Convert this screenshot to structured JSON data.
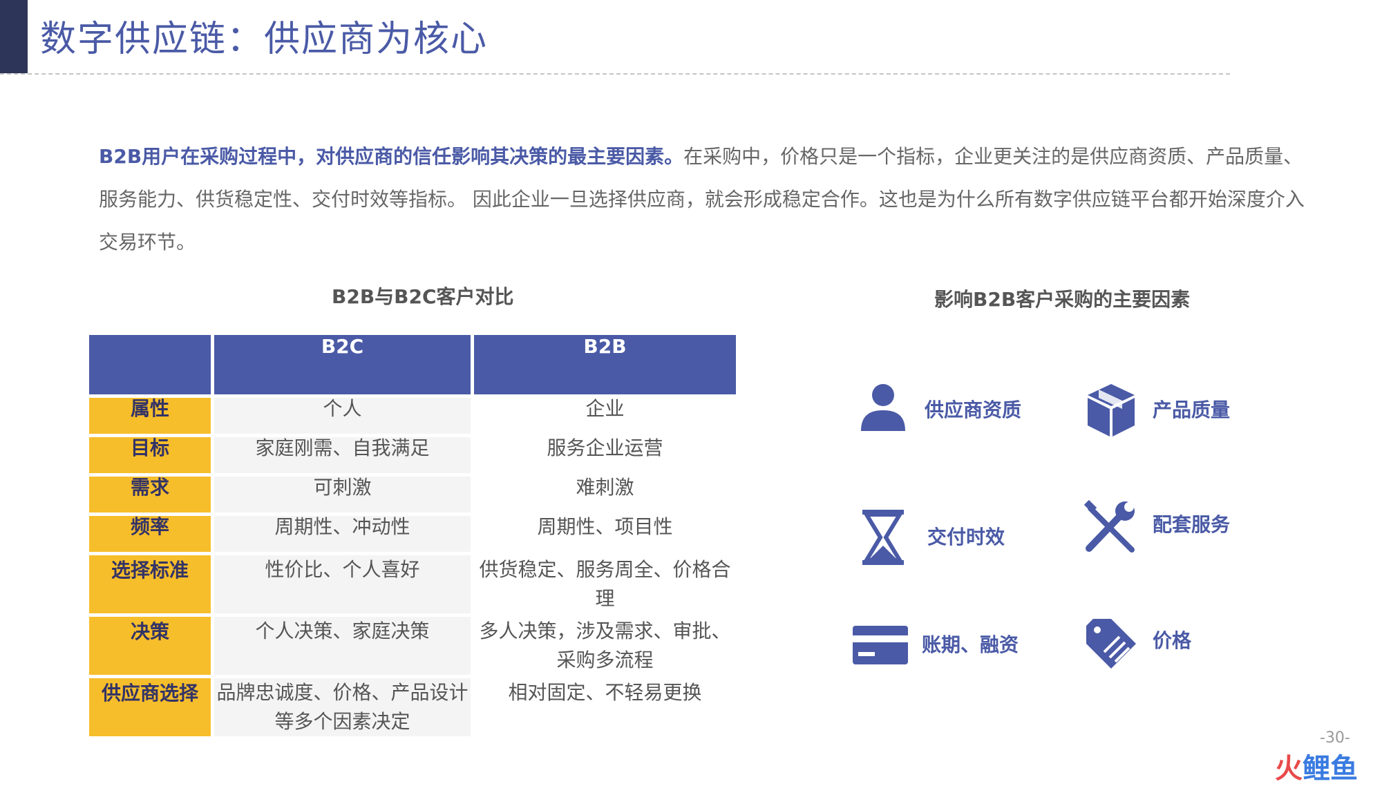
{
  "page": {
    "title": "数字供应链：供应商为核心",
    "page_number": "-30-"
  },
  "intro": {
    "highlight": "B2B用户在采购过程中，对供应商的信任影响其决策的最主要因素。",
    "body": "在采购中，价格只是一个指标，企业更关注的是供应商资质、产品质量、服务能力、供货稳定性、交付时效等指标。 因此企业一旦选择供应商，就会形成稳定合作。这也是为什么所有数字供应链平台都开始深度介入交易环节。"
  },
  "comparison": {
    "title": "B2B与B2C客户对比",
    "headers": [
      "",
      "B2C",
      "B2B"
    ],
    "rows": [
      {
        "label": "属性",
        "b2c": "个人",
        "b2b": "企业"
      },
      {
        "label": "目标",
        "b2c": "家庭刚需、自我满足",
        "b2b": "服务企业运营"
      },
      {
        "label": "需求",
        "b2c": "可刺激",
        "b2b": "难刺激"
      },
      {
        "label": "频率",
        "b2c": "周期性、冲动性",
        "b2b": "周期性、项目性"
      },
      {
        "label": "选择标准",
        "b2c": "性价比、个人喜好",
        "b2b": "供货稳定、服务周全、价格合理"
      },
      {
        "label": "决策",
        "b2c": "个人决策、家庭决策",
        "b2b": "多人决策，涉及需求、审批、采购多流程"
      },
      {
        "label": "供应商选择",
        "b2c": "品牌忠诚度、价格、产品设计等多个因素决定",
        "b2b": "相对固定、不轻易更换"
      }
    ]
  },
  "factors": {
    "title": "影响B2B客户采购的主要因素",
    "items": [
      {
        "label": "供应商资质",
        "icon": "person-icon"
      },
      {
        "label": "产品质量",
        "icon": "package-box-icon"
      },
      {
        "label": "交付时效",
        "icon": "hourglass-icon"
      },
      {
        "label": "配套服务",
        "icon": "tools-icon"
      },
      {
        "label": "账期、融资",
        "icon": "credit-card-icon"
      },
      {
        "label": "价格",
        "icon": "price-tag-icon"
      }
    ]
  },
  "watermark": {
    "text_red": "火",
    "text_blue": "鲤鱼"
  },
  "colors": {
    "primary": "#4a5aa6",
    "accent": "#f7be2b",
    "title_bar": "#2d3559"
  }
}
